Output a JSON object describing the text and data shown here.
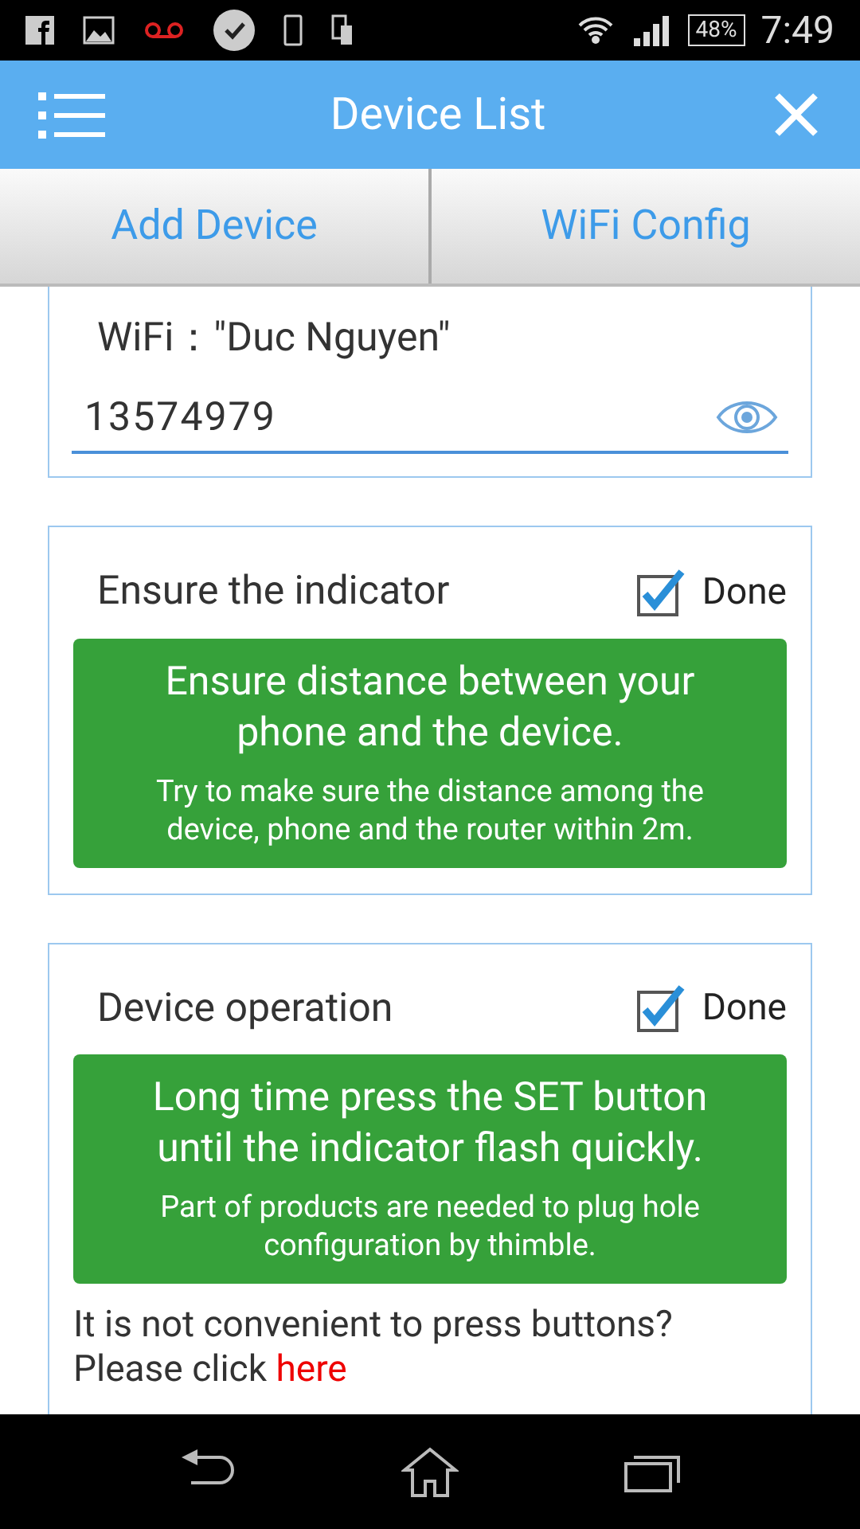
{
  "status_bar": {
    "battery": "48%",
    "time": "7:49"
  },
  "header": {
    "title": "Device List"
  },
  "tabs": [
    {
      "label": "Add Device"
    },
    {
      "label": "WiFi Config"
    }
  ],
  "wifi": {
    "label": "WiFi：\"Duc Nguyen\"",
    "password": "13574979"
  },
  "steps": [
    {
      "title": "Ensure the indicator",
      "checked": true,
      "check_label": "Done",
      "headline": "Ensure distance between your phone and the device.",
      "detail": "Try to make sure the distance among the device, phone and the router within 2m."
    },
    {
      "title": "Device operation",
      "checked": true,
      "check_label": "Done",
      "headline": "Long time press the SET button until the indicator flash quickly.",
      "detail": "Part of products are needed to plug hole configuration by thimble."
    }
  ],
  "help": {
    "question": "It is not convenient to press buttons?",
    "prompt": "Please click",
    "link": "here"
  }
}
